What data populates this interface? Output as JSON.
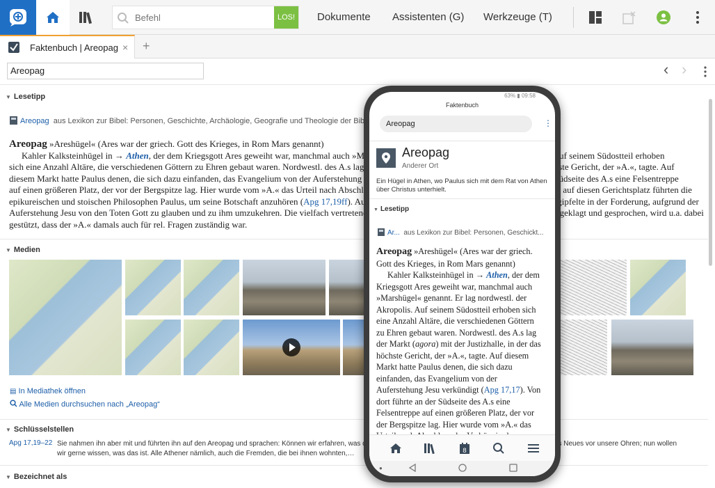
{
  "toolbar": {
    "command_placeholder": "Befehl",
    "go_label": "LOS!",
    "menu": [
      "Dokumente",
      "Assistenten (G)",
      "Werkzeuge (T)"
    ]
  },
  "tab": {
    "label": "Faktenbuch | Areopag",
    "close": "×",
    "add": "+"
  },
  "address": {
    "value": "Areopag",
    "back": "‹",
    "forward": "›"
  },
  "lesetipp": {
    "heading": "Lesetipp",
    "source_link": "Areopag",
    "source_text": "aus Lexikon zur Bibel: Personen, Geschichte, Archäologie, Geografie und Theologie der Bibel"
  },
  "article": {
    "headword": "Areopag",
    "line1_rest": "»Areshügel« (Ares war der griech. Gott des Krieges, in Rom Mars genannt)",
    "line2_a": "Kahler Kalksteinhügel in → ",
    "line2_link": "Athen",
    "line2_b": ", der dem Kriegsgott Ares geweiht war, manchmal auch »Marshügel« genannt. Er lag nordwestl. der Akropolis. Auf seinem Südostteil erhoben",
    "line3": "sich eine Anzahl Altäre, die verschiedenen Göttern zu Ehren gebaut waren. Nordwestl. des A.s lag der Markt (agora) mit der Justizhalle, in der das höchste Gericht, der »A.«, tagte. Auf",
    "line4": "diesem Markt hatte Paulus denen, die sich dazu einfanden, das Evangelium von der Auferstehung Jesu verkündigt (Apg 17,17). Von dort führte an der Südseite des A.s eine Felsentreppe",
    "line5": "auf einen größeren Platz, der vor der Bergspitze lag. Hier wurde vom »A.« das Urteil nach Abschluss eines Prozesses gesprochen. Wohl nur im Hinblick auf diesen Gerichtsplatz führten die",
    "line6_a": "epikureischen und stoischen Philosophen Paulus, um seine Botschaft anzuhören (",
    "line6_link": "Apg 17,19ff",
    "line6_b": "). Auf diesem Platz hielt Paulus seine berühmte Rede, die gipfelte in der Forderung, aufgrund der",
    "line7": "Auferstehung Jesu von den Toten Gott zu glauben und zu ihm umzukehren. Die vielfach vertretene Ansicht, dass Paulus vor dem Gerichtshof des A.s angeklagt und gesprochen, wird u.a. dabei",
    "line8": "gestützt, dass der »A.« damals auch für rel. Fragen zuständig war."
  },
  "medien": {
    "heading": "Medien",
    "open_library": "In Mediathek öffnen",
    "search_all": "Alle Medien durchsuchen nach „Areopag“"
  },
  "schluesselstellen": {
    "heading": "Schlüsselstellen",
    "ref": "Apg 17,19–22",
    "text1": "Sie nahmen ihn aber mit und führten ihn auf den Areopag und sprachen: Können wir erfahren, was das für eine neue Lehre ist, die du lehrst? Denn du bringst etwas Neues vor unsere Ohren; nun wollen",
    "text2": "wir gerne wissen, was das ist. Alle Athener nämlich, auch die Fremden, die bei ihnen wohnten,…"
  },
  "bezeichnet": {
    "heading": "Bezeichnet als"
  },
  "phone": {
    "status": "63% ▮ 09:58",
    "title": "Faktenbuch",
    "search_value": "Areopag",
    "kebab": "⋮",
    "entry_name": "Areopag",
    "entry_type": "Anderer Ort",
    "entry_desc": "Ein Hügel in Athen, wo Paulus sich mit dem Rat von Athen über Christus unterhielt.",
    "sec_heading": "Lesetipp",
    "src_link": "Ar...",
    "src_text": "aus Lexikon zur Bibel: Personen, Geschickt...",
    "article": {
      "headword": "Areopag",
      "l1": "»Areshügel« (Ares war der griech.",
      "l2": "Gott des Krieges, in Rom Mars genannt)",
      "l3a": "Kahler Kalksteinhügel in → ",
      "l3link": "Athen",
      "l3b": ", der dem",
      "l4": "Kriegsgott Ares geweiht war, manchmal auch",
      "l5": "»Marshügel« genannt. Er lag nordwestl. der",
      "l6": "Akropolis. Auf seinem Südostteil erhoben sich",
      "l7": "eine Anzahl Altäre, die verschiedenen Göttern",
      "l8": "zu Ehren gebaut waren. Nordwestl. des A.s lag",
      "l9a": "der Markt (",
      "l9i": "agora",
      "l9b": ") mit der Justizhalle, in der das",
      "l10": "höchste Gericht, der »A.«, tagte. Auf diesem",
      "l11": "Markt hatte Paulus denen, die sich dazu",
      "l12": "einfanden, das Evangelium von der",
      "l13a": "Auferstehung Jesu verkündigt (",
      "l13link": "Apg 17,17",
      "l13b": "). Von",
      "l14": "dort führte an der Südseite des A.s eine",
      "l15": "Felsentreppe auf einen größeren Platz, der vor",
      "l16": "der Bergspitze lag. Hier wurde vom »A.« das",
      "l17": "Urteil nach Abschluss des Verhörs in der"
    },
    "nav_badge": "8"
  },
  "colors": {
    "accent_blue": "#1f6fc5",
    "go_green": "#7cc043",
    "tab_accent": "#f0a030",
    "link": "#1d5ea8"
  },
  "icons": [
    "logo-icon",
    "home-icon",
    "library-icon",
    "search-icon",
    "layout-icon",
    "close-panel-icon",
    "user-avatar-icon",
    "more-vertical-icon"
  ]
}
